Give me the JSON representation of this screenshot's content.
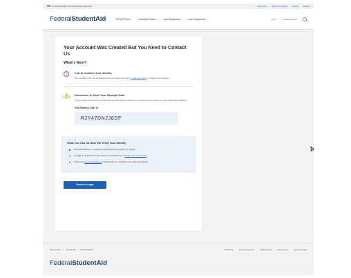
{
  "gov_banner": {
    "text": "An official website of the United States government",
    "links": [
      "Help Center",
      "Submit a Complaint",
      "English",
      "Español"
    ]
  },
  "header": {
    "logo_light": "Federal",
    "logo_bold": "StudentAid",
    "nav": [
      "FAFSA® Form",
      "Loans and Grants",
      "Loan Repayment",
      "Loan Forgiveness"
    ],
    "login": "Log In",
    "create_account": "Create Account",
    "search_icon": "search-icon"
  },
  "main": {
    "title": "Your Account Was Created But You Need to Contact Us",
    "whats_next": "What's Next?",
    "confirm": {
      "icon": "alert-circle-icon",
      "heading": "Call to Confirm Your Identity",
      "text": "We couldn't verify the information you provided. Call us at",
      "phone": "1-800-433-3243",
      "text_end": "to confirm your identity."
    },
    "backup": {
      "icon": "lightbulb-icon",
      "heading": "Remember to Save Your Backup Code",
      "text": "Your backup code lets you access your account in the event that you cannot use any other two-step verification method.",
      "code_label": "Your Backup Code is",
      "code": "RJY47DN2J6DF"
    },
    "after_verify": {
      "heading": "What You Can Do After We Verify Your Identity",
      "item1": "Add information to a student's FAFSA form as a parent or spouse.",
      "item2_start": "Complete the FAFSA form online as a student from a",
      "item2_link": "Freely Associated State",
      "item2_end": ".",
      "item3_start": "View your",
      "item3_link": "account dashboard",
      "item3_end": ", which includes checklists and other information."
    },
    "return_button": "Return to Login"
  },
  "footer": {
    "left_links": [
      "Help Center",
      "Contact Us",
      "Site Feedback"
    ],
    "separator": "|",
    "right_links": [
      "About Us",
      "Announcements",
      "Data Center",
      "Resources",
      "Forms Library"
    ],
    "logo_light": "Federal",
    "logo_bold": "StudentAid"
  }
}
